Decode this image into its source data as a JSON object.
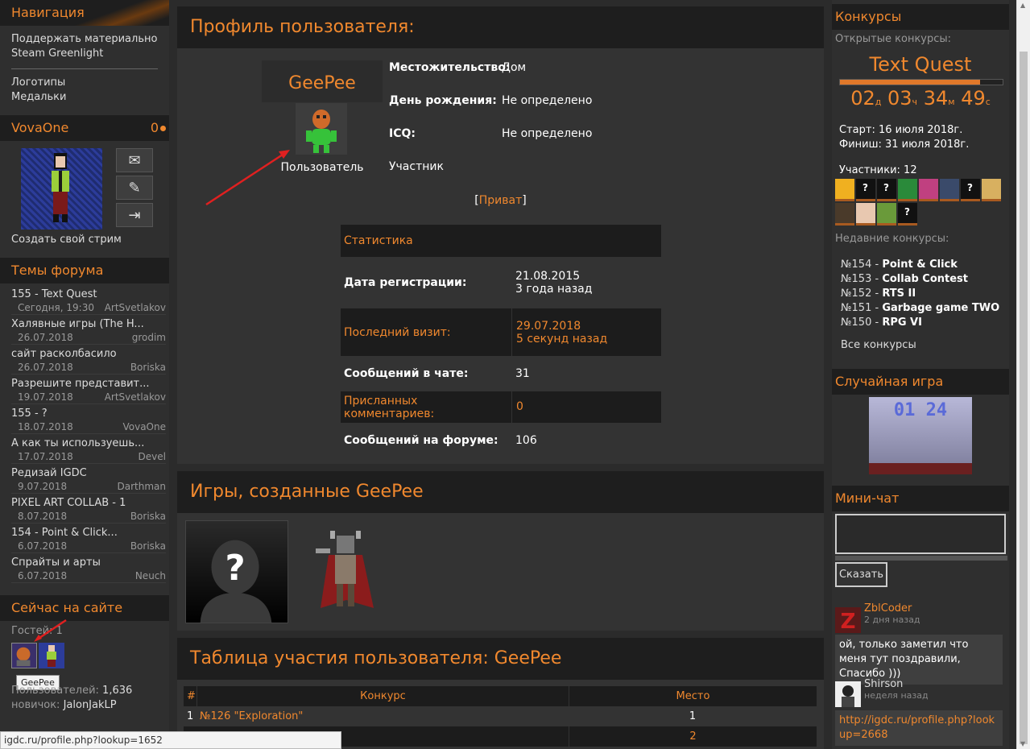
{
  "left": {
    "nav": {
      "title": "Навигация",
      "items": [
        "Поддержать материально",
        "Steam Greenlight",
        "Логотипы",
        "Медальки"
      ]
    },
    "user": {
      "name": "VovaOne",
      "coins": "0",
      "stream_link": "Создать свой стрим"
    },
    "forum": {
      "title": "Темы форума",
      "topics": [
        {
          "title": "155 - Text Quest",
          "date": "Сегодня, 19:30",
          "author": "ArtSvetlakov"
        },
        {
          "title": "Халявные игры (The H...",
          "date": "26.07.2018",
          "author": "grodim"
        },
        {
          "title": "сайт расколбасило",
          "date": "26.07.2018",
          "author": "Boriska"
        },
        {
          "title": "Разрешите представит...",
          "date": "19.07.2018",
          "author": "ArtSvetlakov"
        },
        {
          "title": "155 - ?",
          "date": "18.07.2018",
          "author": "VovaOne"
        },
        {
          "title": "А как ты используешь...",
          "date": "17.07.2018",
          "author": "Devel"
        },
        {
          "title": "Редизай IGDC",
          "date": "9.07.2018",
          "author": "Darthman"
        },
        {
          "title": "PIXEL ART COLLAB - 1",
          "date": "8.07.2018",
          "author": "Boriska"
        },
        {
          "title": "154 - Point & Click...",
          "date": "6.07.2018",
          "author": "Boriska"
        },
        {
          "title": "Спрайты и арты",
          "date": "6.07.2018",
          "author": "Neuch"
        }
      ]
    },
    "online": {
      "title": "Сейчас на сайте",
      "guests": "Гостей: 1",
      "tooltip": "GeePee",
      "users_label": "Пользователей:",
      "users_count": "1,636",
      "newbie_label": "новичок:",
      "newbie_name": "JalonJakLP"
    }
  },
  "status_url": "igdc.ru/profile.php?lookup=1652",
  "profile": {
    "title": "Профиль пользователя:",
    "username": "GeePee",
    "role": "Пользователь",
    "fields": [
      {
        "label": "Местожительство:",
        "value": "Дом"
      },
      {
        "label": "День рождения:",
        "value": "Не определено"
      },
      {
        "label": "ICQ:",
        "value": "Не определено"
      },
      {
        "label": "Участник",
        "value": ""
      }
    ],
    "private_label": "Приват",
    "stats": {
      "title": "Статистика",
      "rows": [
        {
          "label": "Дата регистрации:",
          "value": "21.08.2015",
          "value2": "3 года назад"
        },
        {
          "label": "Последний визит:",
          "value": "29.07.2018",
          "value2": "5 секунд назад"
        },
        {
          "label": "Сообщений в чате:",
          "value": "31"
        },
        {
          "label": "Присланных комментариев:",
          "value": "0"
        },
        {
          "label": "Сообщений на форуме:",
          "value": "106"
        }
      ]
    }
  },
  "games": {
    "title": "Игры, созданные GeePee"
  },
  "participation": {
    "title": "Таблица участия пользователя: GeePee",
    "headers": [
      "#",
      "Конкурс",
      "Место"
    ],
    "rows": [
      {
        "n": "1",
        "contest": "№126 \"Exploration\"",
        "place": "1"
      },
      {
        "n": "",
        "contest": "",
        "place": "2"
      }
    ]
  },
  "right": {
    "contests": {
      "title": "Конкурсы",
      "open_label": "Открытые конкурсы:",
      "current": "Text Quest",
      "progress": 0.86,
      "timer": {
        "d": "02",
        "h": "03",
        "m": "34",
        "s": "49",
        "du": "д",
        "hu": "ч",
        "mu": "м",
        "su": "с"
      },
      "start": "Старт: 16 июля 2018г.",
      "finish": "Финиш: 31 июля 2018г.",
      "participants": "Участники: 12",
      "recent_label": "Недавние конкурсы:",
      "recent": [
        {
          "num": "№154 -",
          "name": "Point & Click"
        },
        {
          "num": "№153 -",
          "name": "Collab Contest"
        },
        {
          "num": "№152 -",
          "name": "RTS II"
        },
        {
          "num": "№151 -",
          "name": "Garbage game TWO"
        },
        {
          "num": "№150 -",
          "name": "RPG VI"
        }
      ],
      "all_link": "Все конкурсы"
    },
    "random": {
      "title": "Случайная игра",
      "game_text": "01 24"
    },
    "chat": {
      "title": "Мини-чат",
      "say_button": "Сказать",
      "messages": [
        {
          "user": "ZblCoder",
          "time": "2 дня назад",
          "text": "ой, только заметил что меня тут поздравили, Спасибо )))"
        },
        {
          "user": "Shirson",
          "time": "неделя назад",
          "text": "http://igdc.ru/profile.php?lookup=2668"
        }
      ]
    }
  },
  "colors": {
    "accent": "#f0882e",
    "bg": "#2b2b2b",
    "header": "#1e1e1e"
  }
}
